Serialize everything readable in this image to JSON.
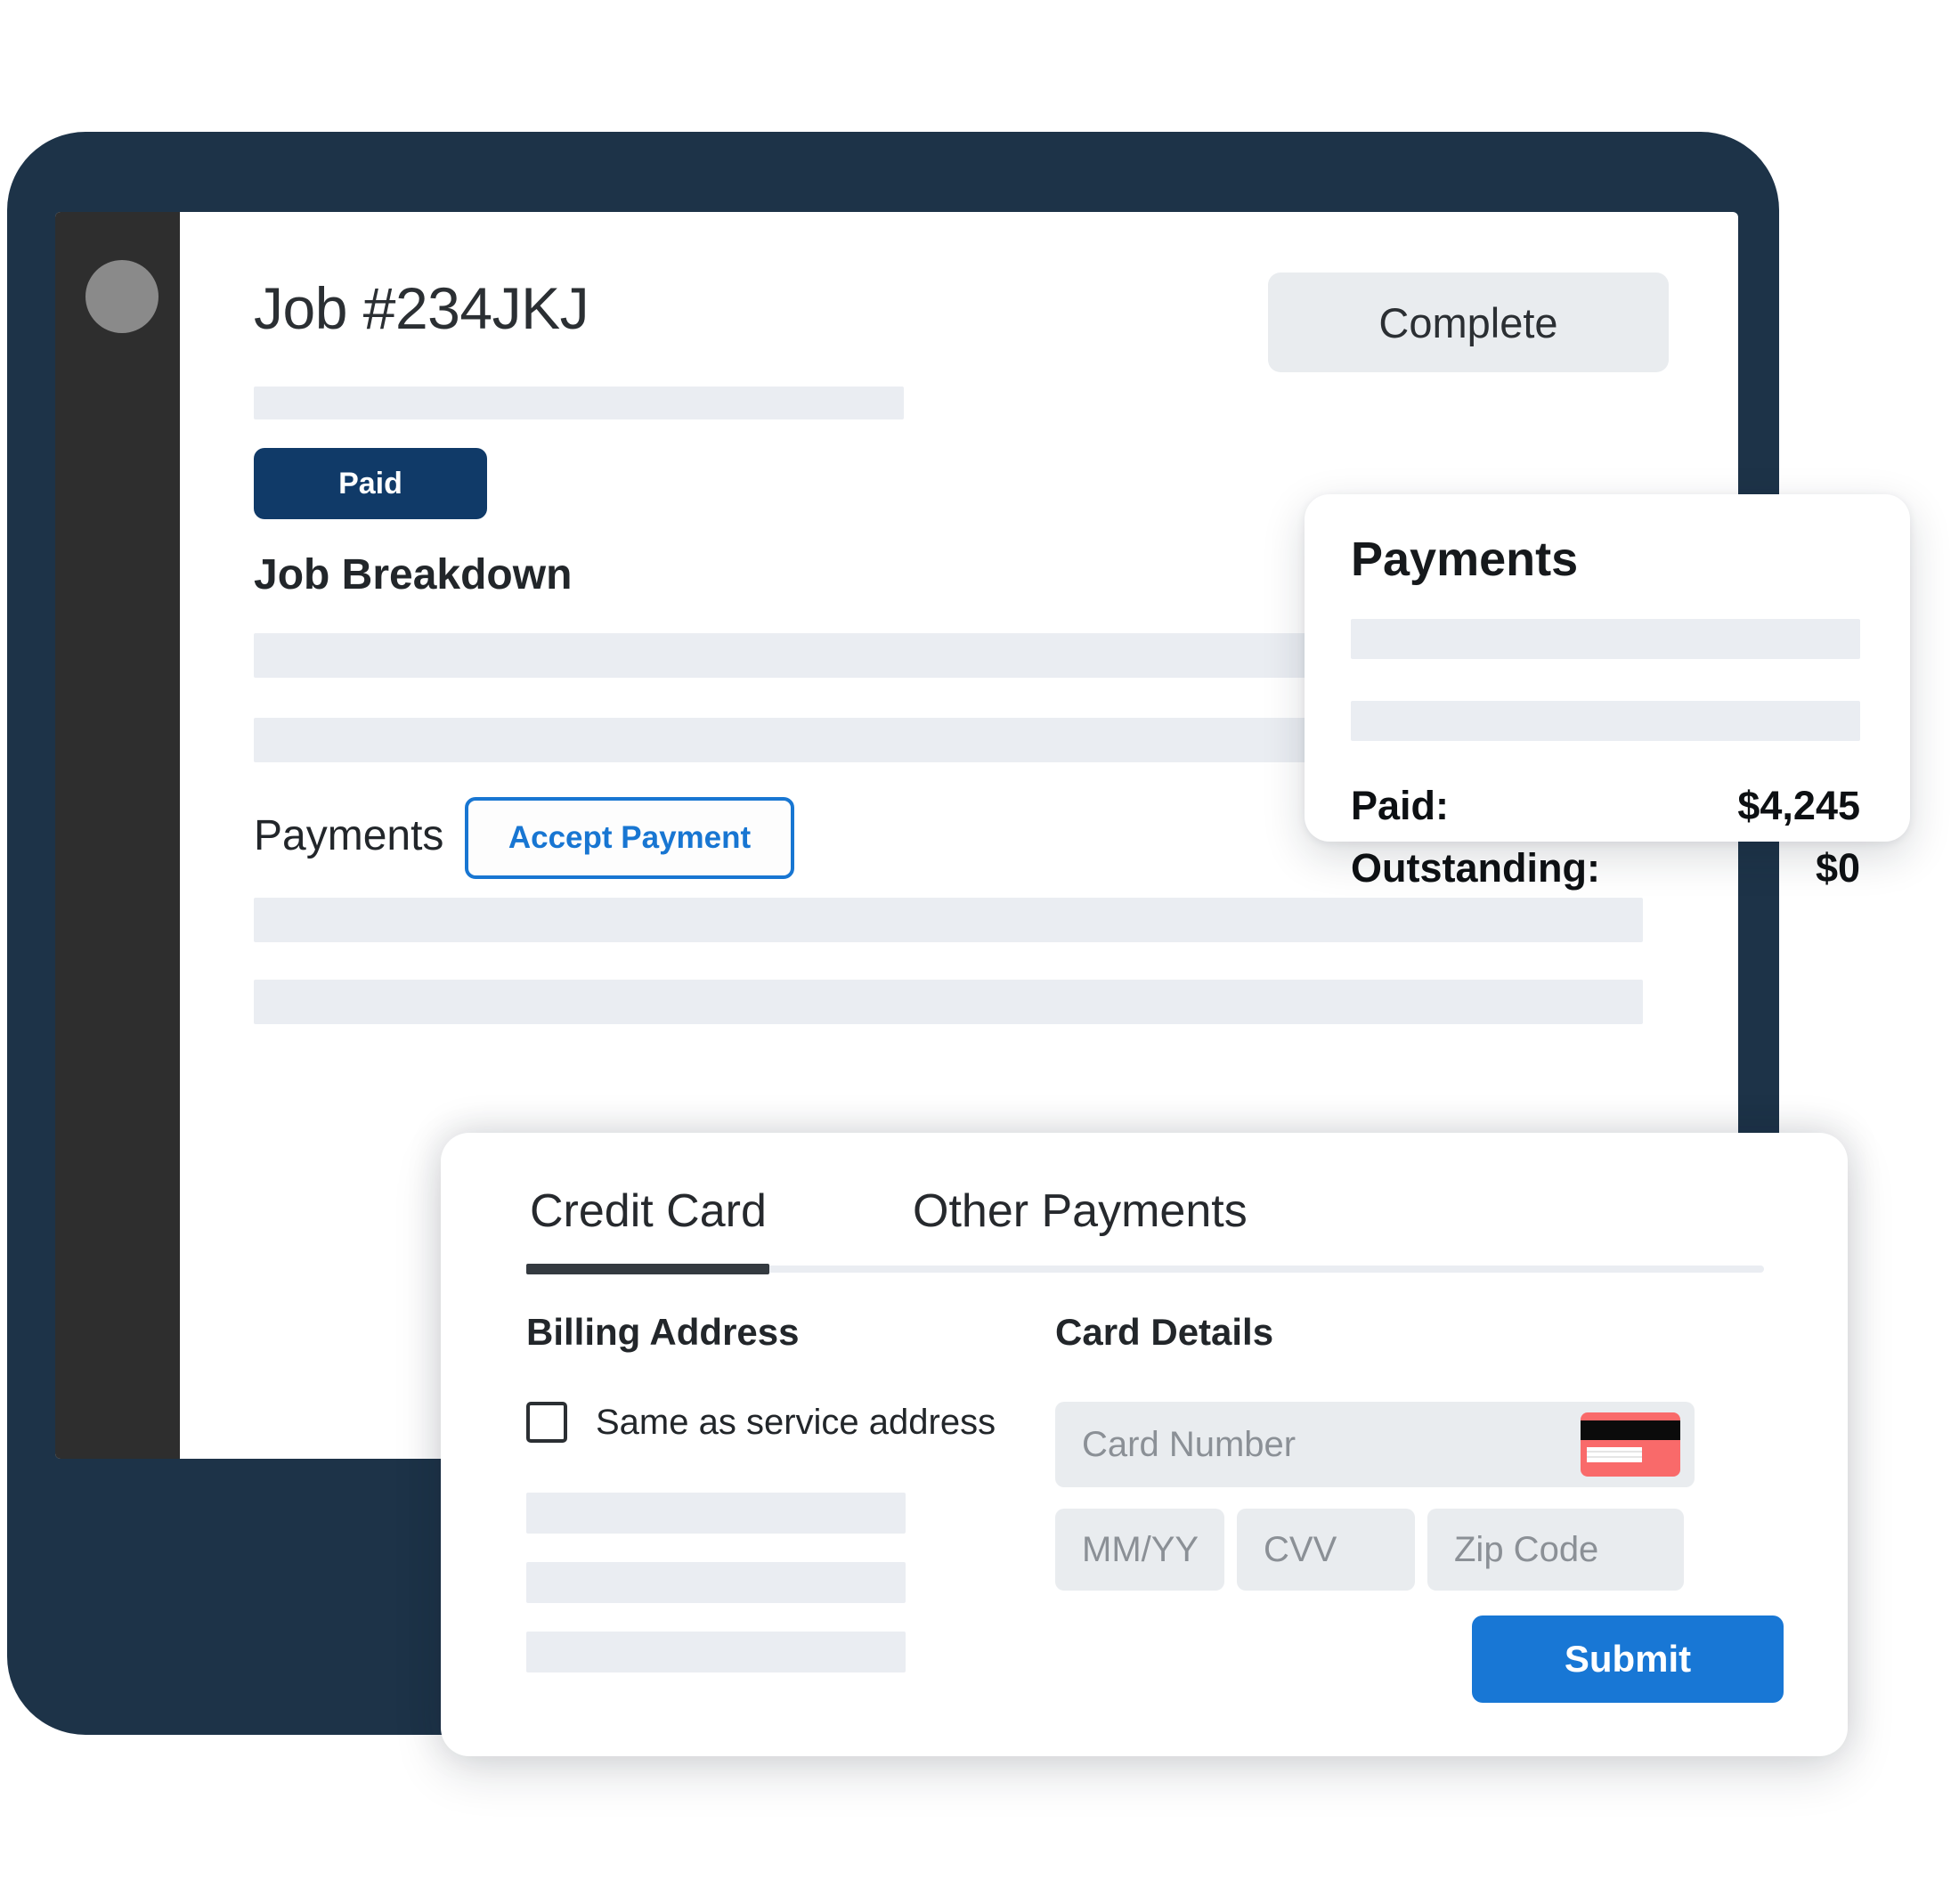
{
  "window": {
    "avatar": "user-avatar"
  },
  "job": {
    "title": "Job #234JKJ",
    "complete_label": "Complete",
    "status_badge": "Paid",
    "breakdown_heading": "Job Breakdown",
    "payments_heading": "Payments",
    "accept_payment_label": "Accept Payment"
  },
  "payments_card": {
    "title": "Payments",
    "paid_label": "Paid:",
    "paid_value": "$4,245",
    "outstanding_label": "Outstanding:",
    "outstanding_value": "$0"
  },
  "modal": {
    "tabs": [
      {
        "label": "Credit Card",
        "active": true
      },
      {
        "label": "Other Payments",
        "active": false
      }
    ],
    "billing": {
      "heading": "Billing Address",
      "same_as_service_label": "Same as service address",
      "same_as_service_checked": false
    },
    "card": {
      "heading": "Card Details",
      "card_number_placeholder": "Card Number",
      "card_number_value": "",
      "expiry_placeholder": "MM/YY",
      "expiry_value": "",
      "cvv_placeholder": "CVV",
      "cvv_value": "",
      "zip_placeholder": "Zip Code",
      "zip_value": "",
      "card_brand_icon": "credit-card-icon"
    },
    "submit_label": "Submit"
  },
  "colors": {
    "frame": "#1d3348",
    "sidebar": "#2e2e2e",
    "paid_badge": "#103a68",
    "accent_blue": "#1877d5",
    "link_blue": "#1876d2",
    "skeleton": "#eaedf2",
    "field": "#e9ecef",
    "card_icon_red": "#f96a6a"
  }
}
